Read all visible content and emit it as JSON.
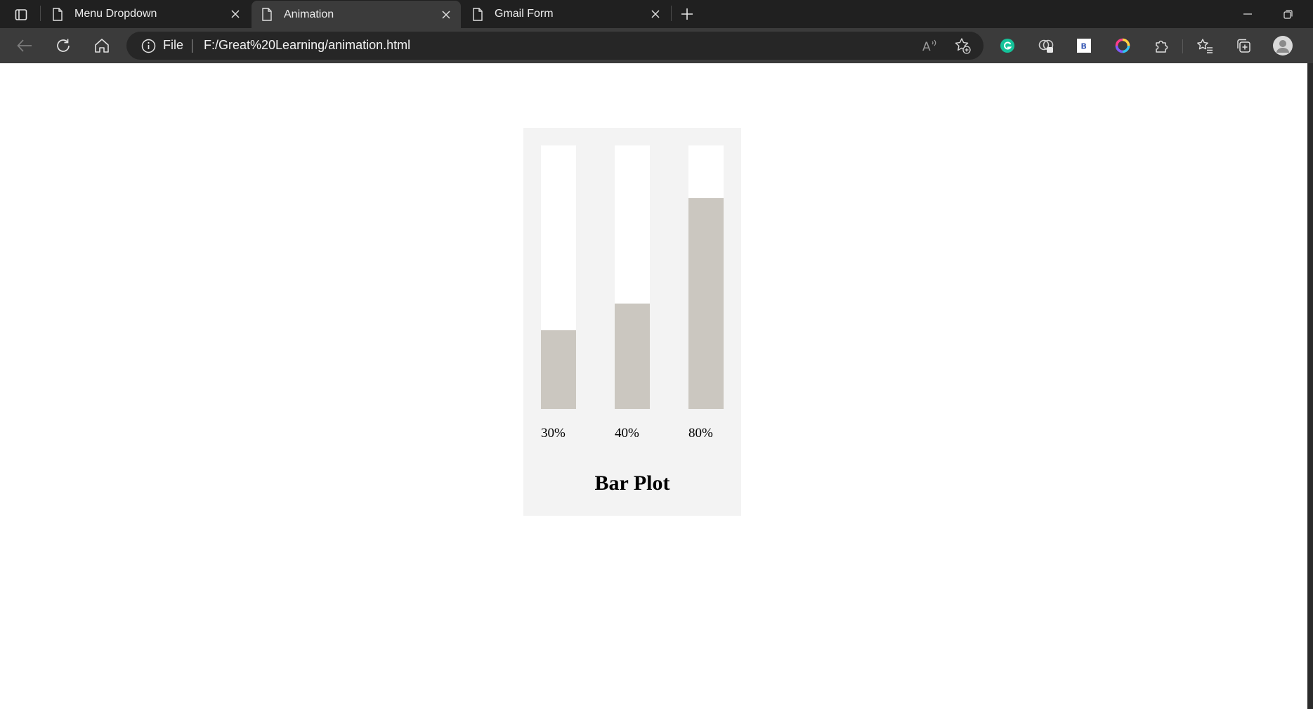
{
  "tabs": [
    {
      "title": "Menu Dropdown",
      "active": false
    },
    {
      "title": "Animation",
      "active": true
    },
    {
      "title": "Gmail Form",
      "active": false
    }
  ],
  "address_bar": {
    "scheme_label": "File",
    "url": "F:/Great%20Learning/animation.html"
  },
  "icons": {
    "tab_actions": "tab-actions-icon",
    "page": "page-icon",
    "close": "close-icon",
    "new_tab": "plus-icon",
    "back": "back-arrow-icon",
    "refresh": "refresh-icon",
    "home": "home-icon",
    "info": "info-icon",
    "read_aloud": "read-aloud-icon",
    "add_favorite": "favorite-add-icon",
    "grammarly": "grammarly-icon",
    "ext_b": "extension-b-icon",
    "color_picker": "color-picker-icon",
    "extensions": "puzzle-icon",
    "favorites": "favorites-icon",
    "collections": "collections-icon",
    "profile": "profile-avatar-icon",
    "minimize": "minimize-icon",
    "restore": "restore-icon"
  },
  "colors": {
    "tabbar": "#202020",
    "toolbar": "#3b3b3b",
    "card_bg": "#f3f3f3",
    "bar_track": "#ffffff",
    "bar_fill": "#cbc7c0"
  },
  "chart_data": {
    "type": "bar",
    "title": "Bar Plot",
    "categories": [
      "30%",
      "40%",
      "80%"
    ],
    "values": [
      30,
      40,
      80
    ],
    "ylim": [
      0,
      100
    ],
    "xlabel": "",
    "ylabel": "",
    "grid": false
  }
}
